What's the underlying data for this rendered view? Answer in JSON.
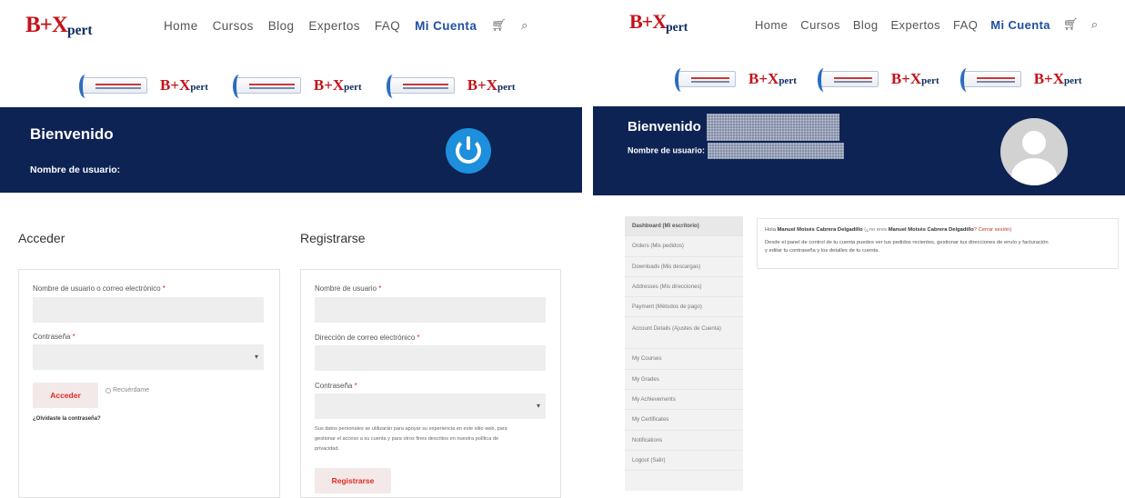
{
  "brand": {
    "logo_main": "B+X",
    "logo_sub": "pert"
  },
  "nav": {
    "items": [
      "Home",
      "Cursos",
      "Blog",
      "Expertos",
      "FAQ"
    ],
    "account": "Mi Cuenta",
    "icons": [
      "cart-icon",
      "search-icon"
    ]
  },
  "banner": {
    "logo_main": "B+X",
    "logo_sub": "pert",
    "repeat": 3
  },
  "left": {
    "welcome": "Bienvenido",
    "username_label": "Nombre de usuario:",
    "login": {
      "title": "Acceder",
      "user_label": "Nombre de usuario o correo electrónico",
      "password_label": "Contraseña",
      "required_mark": "*",
      "button": "Acceder",
      "remember": "Recuérdame",
      "lost_password": "¿Olvidaste la contraseña?"
    },
    "register": {
      "title": "Registrarse",
      "user_label": "Nombre de usuario",
      "email_label": "Dirección de correo electrónico",
      "password_label": "Contraseña",
      "required_mark": "*",
      "privacy_lines": [
        "Sus datos personales se utilizarán para apoyar su experiencia en este sitio web, para",
        "gestionar el acceso a su cuenta y para otros fines descritos en nuestra política de",
        "privacidad."
      ],
      "button": "Registrarse"
    }
  },
  "right": {
    "welcome": "Bienvenido",
    "username_label": "Nombre de usuario:",
    "menu": [
      "Dashboard (Mi escritorio)",
      "Orders (Mis pedidos)",
      "Downloads (Mis descargas)",
      "Addresses (Mis direcciones)",
      "Payment (Métodos de pago)",
      "Account Details (Ajustes de Cuenta)",
      "My Courses",
      "My Grades",
      "My Achievements",
      "My Certificates",
      "Notifications",
      "Logout (Salir)"
    ],
    "greeting": {
      "hello": "Hola",
      "name": "Manuel Moisés Cabrera Delgadillo",
      "not_you": "(¿no eres",
      "name2": "Manuel Moisés Cabrera Delgadillo",
      "logout": "? Cerrar sesión)"
    },
    "dashboard_text_1": "Desde el panel de control de tu cuenta puedes ver tus pedidos recientes, gestionar tus direcciones de envío y facturación",
    "dashboard_text_2": "y editar tu contraseña y los detalles de tu cuenta."
  },
  "colors": {
    "band": "#0d2354",
    "accent": "#1f4fa3",
    "brand_red": "#c4121a",
    "button_text": "#e02b20",
    "power": "#1d8fdc"
  }
}
